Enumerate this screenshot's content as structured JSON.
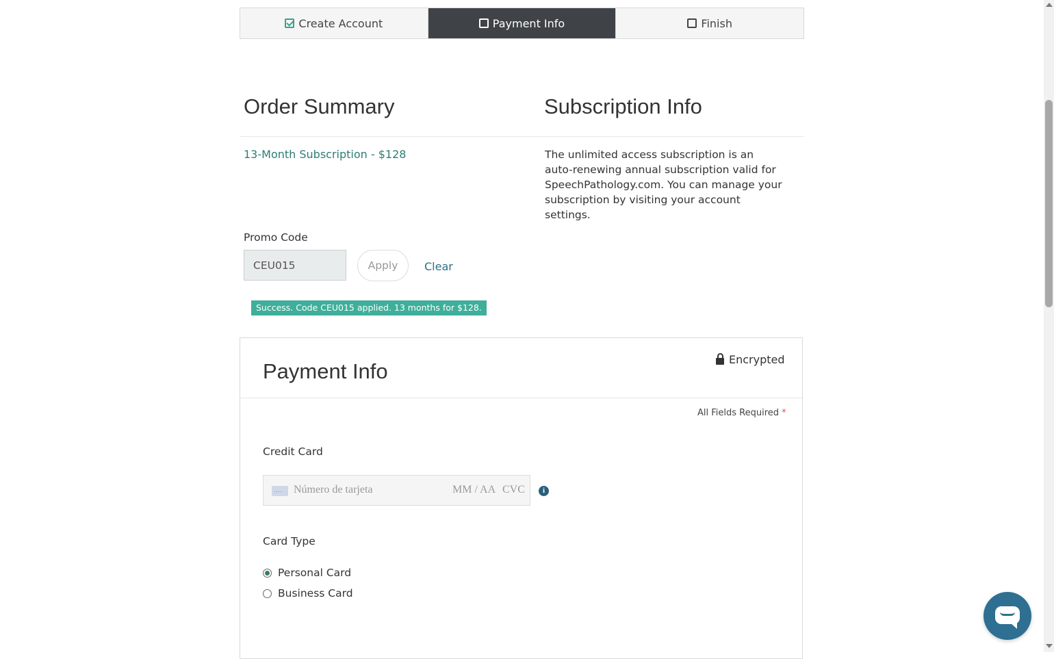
{
  "steps": [
    {
      "label": "Create Account",
      "icon": "checked-square-icon",
      "active": false
    },
    {
      "label": "Payment Info",
      "icon": "square-icon",
      "active": true
    },
    {
      "label": "Finish",
      "icon": "square-icon",
      "active": false
    }
  ],
  "order_summary": {
    "title": "Order Summary",
    "item": "13-Month Subscription - $128"
  },
  "subscription_info": {
    "title": "Subscription Info",
    "text": "The unlimited access subscription is an auto-renewing annual subscription valid for SpeechPathology.com. You can manage your subscription by visiting your account settings."
  },
  "promo": {
    "label": "Promo Code",
    "value": "CEU015",
    "apply_label": "Apply",
    "clear_label": "Clear",
    "success_message": "Success. Code CEU015 applied. 13 months for $128."
  },
  "payment": {
    "title": "Payment Info",
    "encrypted_label": "Encrypted",
    "required_label": "All Fields Required",
    "required_star": "*",
    "credit_card_label": "Credit Card",
    "card_number_placeholder": "Número de tarjeta",
    "expiry_placeholder": "MM / AA",
    "cvc_placeholder": "CVC",
    "card_type_label": "Card Type",
    "card_types": [
      {
        "label": "Personal Card",
        "selected": true
      },
      {
        "label": "Business Card",
        "selected": false
      }
    ]
  },
  "colors": {
    "accent": "#2c7d74",
    "success": "#3fae9a",
    "active_step": "#3f4347",
    "link": "#2a6f8a",
    "chat": "#2e6f92"
  }
}
